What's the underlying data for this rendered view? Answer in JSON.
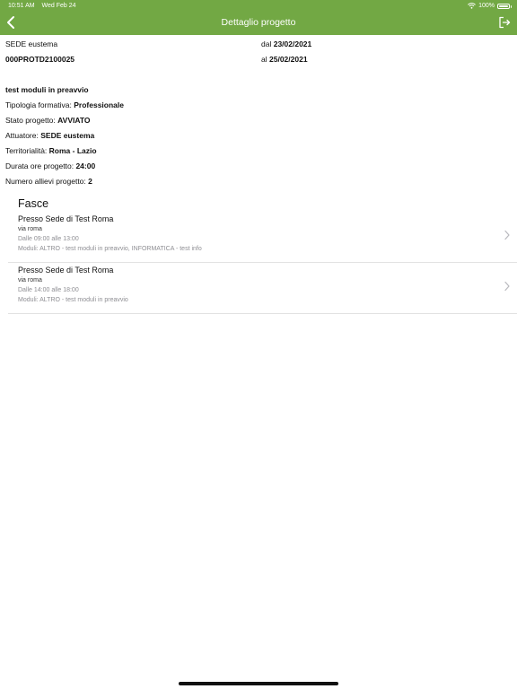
{
  "status_bar": {
    "time": "10:51 AM",
    "date": "Wed Feb 24",
    "battery": "100%"
  },
  "header": {
    "title": "Dettaglio progetto"
  },
  "summary": {
    "sede": "SEDE eustema",
    "codice": "000PROTD2100025",
    "dal_label": "dal",
    "dal_value": "23/02/2021",
    "al_label": "al",
    "al_value": "25/02/2021"
  },
  "details": {
    "title": "test moduli in preavvio",
    "tipologia_label": "Tipologia formativa:",
    "tipologia_value": "Professionale",
    "stato_label": "Stato progetto:",
    "stato_value": "AVVIATO",
    "attuatore_label": "Attuatore:",
    "attuatore_value": "SEDE eustema",
    "territorialita_label": "Territorialità:",
    "territorialita_value": "Roma - Lazio",
    "durata_label": "Durata ore progetto:",
    "durata_value": "24:00",
    "allievi_label": "Numero allievi progetto:",
    "allievi_value": "2"
  },
  "fasce": {
    "title": "Fasce",
    "items": [
      {
        "luogo": "Presso Sede di Test Roma",
        "indirizzo": "via roma",
        "orario": "Dalle 09:00 alle 13:00",
        "moduli": "Moduli: ALTRO - test moduli in preavvio, INFORMATICA - test info"
      },
      {
        "luogo": "Presso Sede di Test Roma",
        "indirizzo": "via roma",
        "orario": "Dalle 14:00 alle 18:00",
        "moduli": "Moduli: ALTRO - test moduli in preavvio"
      }
    ]
  },
  "icons": {
    "back": "chevron-left-icon",
    "logout": "logout-icon",
    "wifi": "wifi-icon",
    "battery": "battery-icon",
    "row_chevron": "chevron-right-icon"
  },
  "colors": {
    "header_bg": "#72a844",
    "text": "#111111",
    "secondary_text": "#8e8e93"
  }
}
